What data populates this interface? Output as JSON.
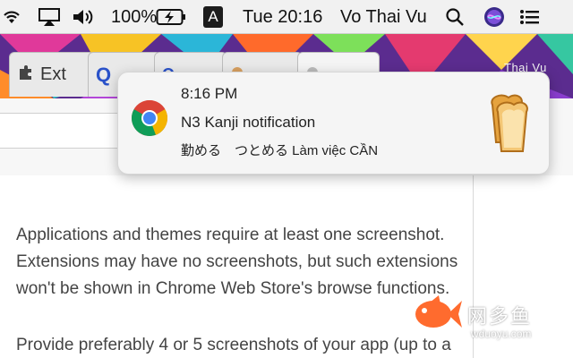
{
  "menubar": {
    "battery_percent": "100%",
    "input_badge": "A",
    "clock": "Tue 20:16",
    "user": "Vo Thai Vu",
    "icons": [
      "wifi-icon",
      "airplay-icon",
      "volume-icon",
      "battery-charging-icon",
      "search-icon",
      "siri-icon",
      "notification-center-icon"
    ]
  },
  "browser": {
    "tabs": [
      {
        "label": "Ext",
        "icon": "puzzle-icon"
      },
      {
        "label": "",
        "icon": "q-icon"
      },
      {
        "label": "",
        "icon": "q-icon"
      },
      {
        "label": "",
        "icon": "tab-icon"
      },
      {
        "label": "",
        "icon": "tab-icon"
      }
    ],
    "profile_label": "Thai Vu"
  },
  "notification": {
    "time": "8:16 PM",
    "title": "N3 Kanji notification",
    "body": "勤める　つとめる Làm việc CẦN",
    "app_icon": "chrome-icon",
    "content_image": "bread-toast-icon"
  },
  "content": {
    "paragraph1": [
      "Applications and themes require at least one screenshot.",
      "Extensions may have no screenshots, but such extensions",
      "won't be shown in Chrome Web Store's browse functions."
    ],
    "paragraph2": "Provide preferably 4 or 5 screenshots of your app (up to a"
  },
  "watermark": {
    "cn": "网多鱼",
    "url": "wduoyu.com"
  }
}
